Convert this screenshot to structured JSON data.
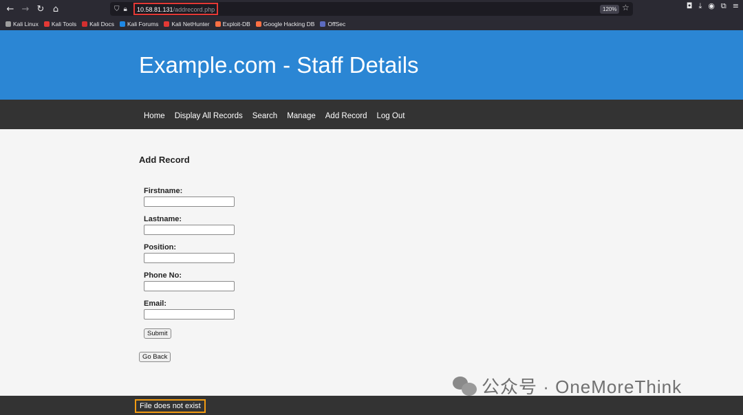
{
  "browser": {
    "url_host": "10.58.81.131",
    "url_path": "/addrecord.php",
    "zoom": "120%",
    "bookmarks": [
      {
        "label": "Kali Linux",
        "color": "#9e9e9e"
      },
      {
        "label": "Kali Tools",
        "color": "#e53935"
      },
      {
        "label": "Kali Docs",
        "color": "#d32f2f"
      },
      {
        "label": "Kali Forums",
        "color": "#1e88e5"
      },
      {
        "label": "Kali NetHunter",
        "color": "#e53935"
      },
      {
        "label": "Exploit-DB",
        "color": "#ff7043"
      },
      {
        "label": "Google Hacking DB",
        "color": "#ff7043"
      },
      {
        "label": "OffSec",
        "color": "#5c6bc0"
      }
    ]
  },
  "site": {
    "title": "Example.com - Staff Details",
    "nav": [
      "Home",
      "Display All Records",
      "Search",
      "Manage",
      "Add Record",
      "Log Out"
    ]
  },
  "form": {
    "heading": "Add Record",
    "fields": [
      {
        "label": "Firstname:",
        "value": ""
      },
      {
        "label": "Lastname:",
        "value": ""
      },
      {
        "label": "Position:",
        "value": ""
      },
      {
        "label": "Phone No:",
        "value": ""
      },
      {
        "label": "Email:",
        "value": ""
      }
    ],
    "submit_label": "Submit",
    "back_label": "Go Back"
  },
  "footer": {
    "message": "File does not exist"
  },
  "watermark": {
    "text": "公众号 · OneMoreThink"
  },
  "colors": {
    "banner": "#2b86d4",
    "nav": "#333333",
    "url_highlight": "#e53935",
    "footer_highlight": "#f39c12"
  }
}
